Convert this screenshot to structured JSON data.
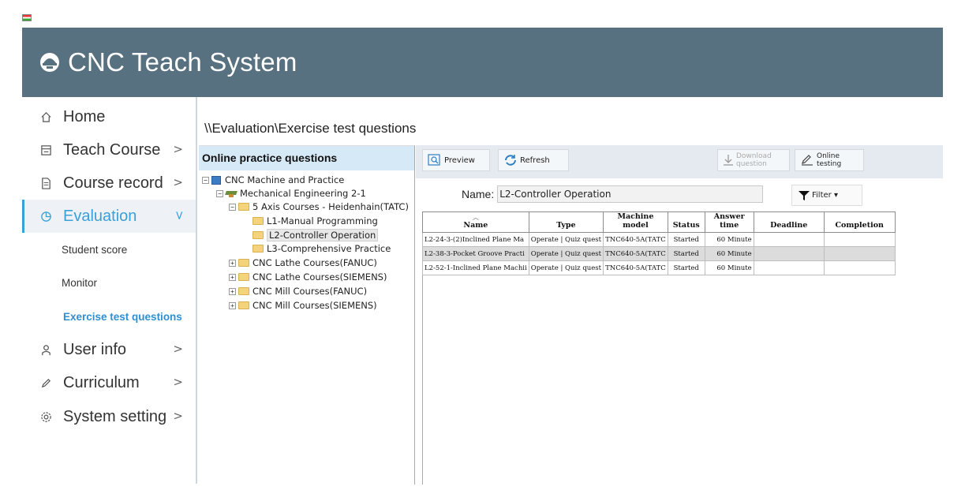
{
  "app": {
    "title": "CNC Teach System",
    "icon": "cnc-app-icon"
  },
  "sidebar": {
    "items": [
      {
        "label": "Home",
        "icon": "home-icon",
        "has_chevron": false
      },
      {
        "label": "Teach Course",
        "icon": "monitor-icon",
        "has_chevron": true
      },
      {
        "label": "Course record",
        "icon": "document-icon",
        "has_chevron": true
      },
      {
        "label": "Evaluation",
        "icon": "chart-icon",
        "has_chevron": true,
        "active": true,
        "children": [
          "Student score",
          "Monitor",
          "Exercise test questions"
        ]
      },
      {
        "label": "User info",
        "icon": "user-icon",
        "has_chevron": true
      },
      {
        "label": "Curriculum",
        "icon": "pen-icon",
        "has_chevron": true
      },
      {
        "label": "System setting",
        "icon": "gear-icon",
        "has_chevron": true
      }
    ],
    "active_color": "#3aa0d8"
  },
  "breadcrumb": "\\\\Evaluation\\Exercise test questions",
  "tree": {
    "header": "Online practice questions",
    "nodes": [
      "CNC Machine and Practice",
      "Mechanical Engineering 2-1",
      "5 Axis Courses - Heidenhain(TATC)",
      "L1-Manual Programming",
      "L2-Controller Operation",
      "L3-Comprehensive Practice",
      "CNC Lathe Courses(FANUC)",
      "CNC Lathe Courses(SIEMENS)",
      "CNC Mill Courses(FANUC)",
      "CNC Mill Courses(SIEMENS)"
    ],
    "selected": "L2-Controller Operation"
  },
  "toolbar": {
    "preview": "Preview",
    "refresh": "Refresh",
    "download_line1": "Download",
    "download_line2": "question",
    "online_line1": "Online",
    "online_line2": "testing"
  },
  "filter_bar": {
    "name_label": "Name:",
    "name_value": "L2-Controller Operation",
    "filter_label": "Filter ▾"
  },
  "table": {
    "columns": [
      "Name",
      "Type",
      "Machine model",
      "Status",
      "Answer time",
      "Deadline",
      "Completion"
    ],
    "rows": [
      [
        "L2-24-3-(2)Inclined Plane Ma",
        "Operate | Quiz quest",
        "TNC640-5A(TATC",
        "Started",
        "60 Minute",
        "",
        ""
      ],
      [
        "L2-38-3-Pocket Groove Practi",
        "Operate | Quiz quest",
        "TNC640-5A(TATC",
        "Started",
        "60 Minute",
        "",
        ""
      ],
      [
        "L2-52-1-Inclined Plane Machii",
        "Operate | Quiz quest",
        "TNC640-5A(TATC",
        "Started",
        "60 Minute",
        "",
        ""
      ]
    ]
  },
  "colors": {
    "header_bg": "#577180",
    "tree_header_bg": "#d6e9f6",
    "toolbar_bg": "#e4eaf0"
  }
}
